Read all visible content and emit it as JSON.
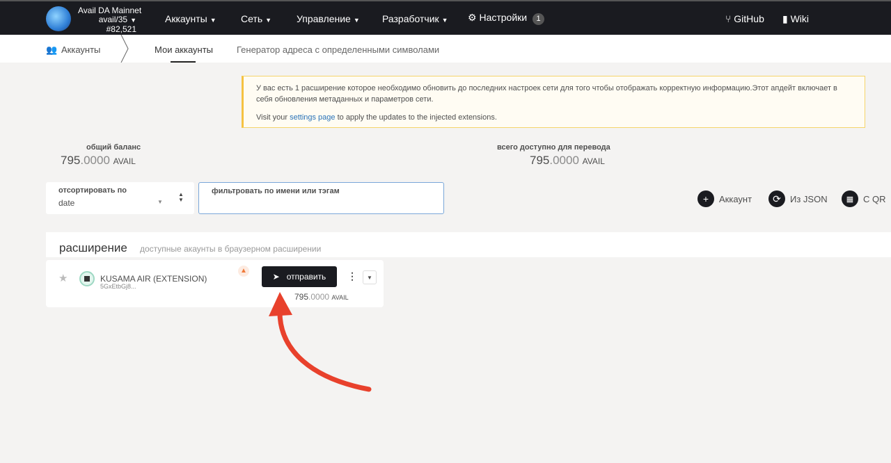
{
  "header": {
    "chain_name": "Avail DA Mainnet",
    "runtime": "avail/35",
    "block": "#82,521",
    "nav": [
      {
        "label": "Аккаунты"
      },
      {
        "label": "Сеть"
      },
      {
        "label": "Управление"
      },
      {
        "label": "Разработчик"
      },
      {
        "label": "Настройки",
        "badge": "1"
      }
    ],
    "links": [
      {
        "label": "GitHub"
      },
      {
        "label": "Wiki"
      }
    ]
  },
  "subnav": {
    "section": "Аккаунты",
    "tabs": [
      {
        "label": "Мои аккаунты",
        "active": true
      },
      {
        "label": "Генератор адреса с определенными символами"
      }
    ]
  },
  "warning": {
    "line1": "У вас есть 1 расширение которое необходимо обновить до последних настроек сети для того чтобы отображать корректную информацию.Этот апдейт включает в себя обновления метаданных и параметров сети.",
    "line2_pre": "Visit your ",
    "line2_link": "settings page",
    "line2_post": " to apply the updates to the injected extensions."
  },
  "summary": {
    "total_label": "общий баланс",
    "total_int": "795",
    "total_dec": ".0000",
    "unit": "AVAIL",
    "transferable_label": "всего доступно для перевода",
    "transferable_int": "795",
    "transferable_dec": ".0000"
  },
  "controls": {
    "sort_label": "отсортировать по",
    "sort_value": "date",
    "filter_label": "фильтровать по имени или тэгам",
    "add_account": "Аккаунт",
    "from_json": "Из JSON",
    "from_qr": "С QR"
  },
  "extension": {
    "title": "расширение",
    "subtitle": "доступные акаунты в браузерном расширении"
  },
  "account": {
    "name": "KUSAMA AIR (EXTENSION)",
    "address": "5GxEtbGj8...",
    "send": "отправить",
    "balance_int": "795",
    "balance_dec": ".0000",
    "unit": "AVAIL"
  },
  "colors": {
    "topbar": "#1a1b20",
    "arrow": "#e8412c",
    "warning_border": "#f5c242"
  }
}
